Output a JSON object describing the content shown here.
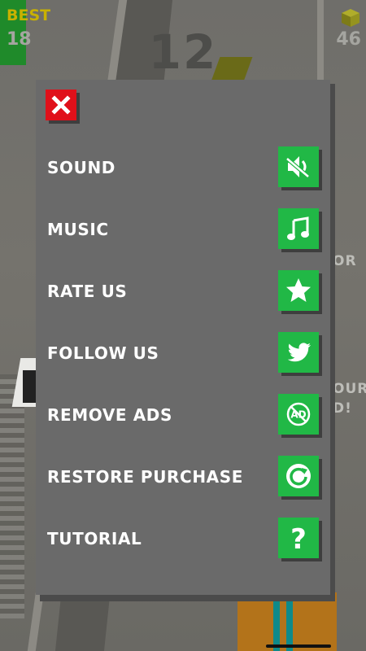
{
  "hud": {
    "best_label": "BEST",
    "best_value": "18",
    "score": "12",
    "coins": "46"
  },
  "background_text": {
    "or": "OR",
    "our": "OUR",
    "d": "D!"
  },
  "menu": {
    "close_icon": "close-icon",
    "items": [
      {
        "label": "SOUND",
        "icon": "sound-off-icon"
      },
      {
        "label": "MUSIC",
        "icon": "music-note-icon"
      },
      {
        "label": "RATE US",
        "icon": "star-icon"
      },
      {
        "label": "FOLLOW US",
        "icon": "twitter-bird-icon"
      },
      {
        "label": "REMOVE ADS",
        "icon": "remove-ads-icon"
      },
      {
        "label": "RESTORE PURCHASE",
        "icon": "restore-icon"
      },
      {
        "label": "TUTORIAL",
        "icon": "question-mark-icon"
      }
    ]
  },
  "colors": {
    "panel": "#6a6a6a",
    "button_green": "#21b846",
    "close_red": "#e0101a",
    "best_gold": "#c9b100"
  }
}
